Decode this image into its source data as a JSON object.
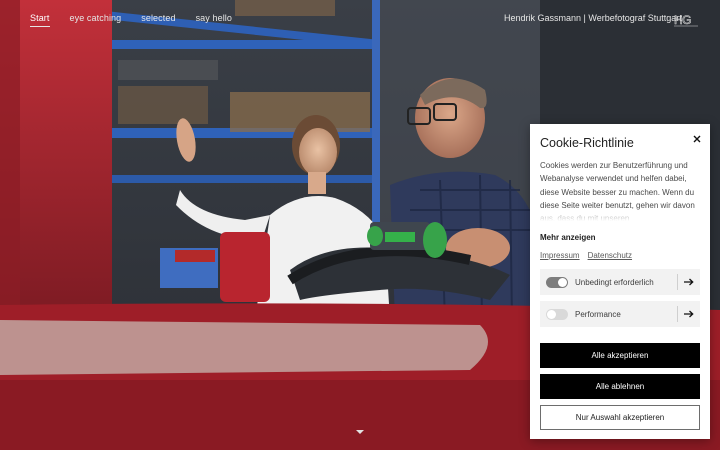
{
  "nav": {
    "items": [
      {
        "label": "Start",
        "active": true
      },
      {
        "label": "eye catching",
        "active": false
      },
      {
        "label": "selected",
        "active": false
      },
      {
        "label": "say hello",
        "active": false
      }
    ],
    "brand": "Hendrik Gassmann | Werbefotograf Stuttgart",
    "logo": "HG"
  },
  "cookie": {
    "title": "Cookie-Richtlinie",
    "close_icon": "close-icon",
    "text": "Cookies werden zur Benutzerführung und Webanalyse verwendet und helfen dabei, diese Website besser zu machen. Wenn du diese Seite weiter benutzt, gehen wir davon aus, dass du mit unseren",
    "more": "Mehr anzeigen",
    "links": {
      "impressum": "Impressum",
      "datenschutz": "Datenschutz"
    },
    "options": [
      {
        "label": "Unbedingt erforderlich",
        "enabled": true
      },
      {
        "label": "Performance",
        "enabled": false
      }
    ],
    "buttons": {
      "accept_all": "Alle akzeptieren",
      "reject_all": "Alle ablehnen",
      "accept_selection": "Nur Auswahl akzeptieren"
    }
  },
  "colors": {
    "toggle_on": "#7d7d7d",
    "toggle_off": "#d9d9d9",
    "button_dark": "#000000",
    "machine_red": "#b3242f"
  }
}
